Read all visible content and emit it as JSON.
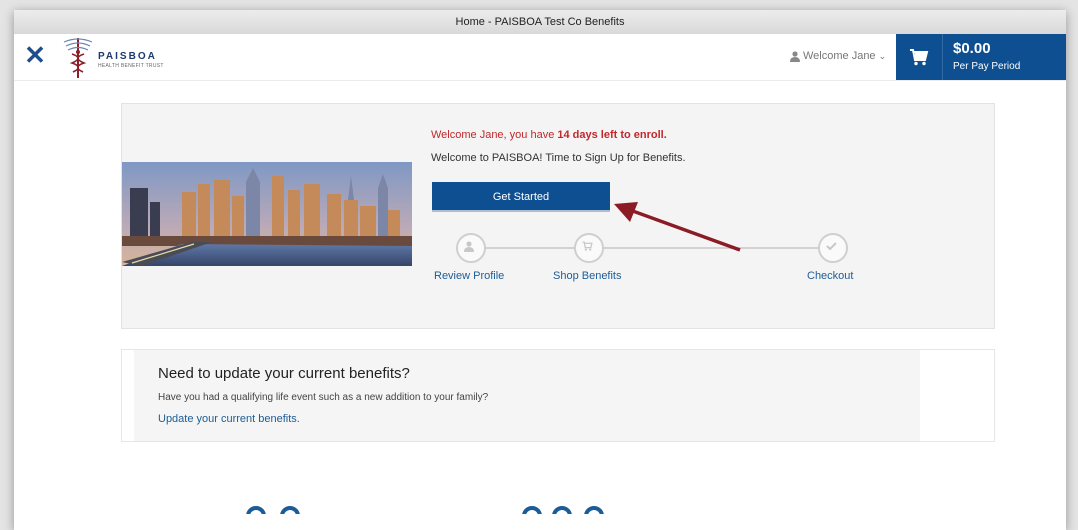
{
  "window": {
    "title": "Home - PAISBOA Test Co Benefits"
  },
  "header": {
    "close_icon": "close-icon",
    "logo": {
      "name": "PAISBOA",
      "tagline": "HEALTH BENEFIT TRUST"
    },
    "welcome": "Welcome Jane",
    "cart": {
      "price": "$0.00",
      "period": "Per Pay Period"
    }
  },
  "hero": {
    "enroll_prefix": "Welcome Jane, you have ",
    "enroll_days": "14 days left to enroll.",
    "intro": "Welcome to PAISBOA!  Time to Sign Up for Benefits.",
    "button": "Get Started",
    "steps": [
      {
        "label": "Review Profile",
        "icon": "user-icon"
      },
      {
        "label": "Shop Benefits",
        "icon": "cart-icon"
      },
      {
        "label": "Checkout",
        "icon": "check-icon"
      }
    ]
  },
  "update": {
    "title": "Need to update your current benefits?",
    "question": "Have you had a qualifying life event such as a new addition to your family?",
    "link": "Update your current benefits."
  },
  "colors": {
    "brand_blue": "#0d4f90",
    "alert_red": "#c0282c",
    "annotation_arrow": "#8b1c26"
  }
}
